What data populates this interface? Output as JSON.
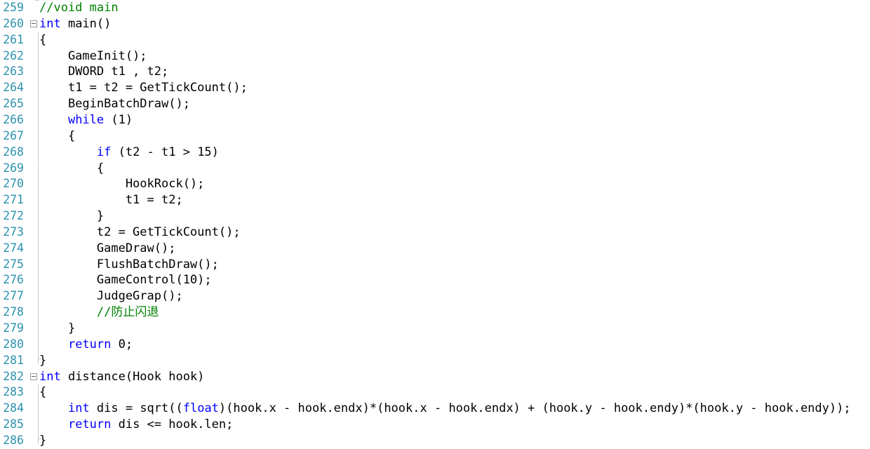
{
  "editor": {
    "name": "source-code-view",
    "language": "C++",
    "colors": {
      "background": "#ffffff",
      "line_number": "#2B91AF",
      "keyword": "#0000FF",
      "comment": "#008000",
      "plain_text": "#000000",
      "fold_guide": "#c8c8c8",
      "fold_box_border": "#9a9a9a"
    },
    "first_line_number": 259,
    "last_line_number": 286,
    "fold_markers": [
      260,
      282
    ]
  },
  "lines": [
    {
      "number": "259",
      "fold": false,
      "guide": "none",
      "tokens": [
        {
          "t": "//void main",
          "c": "cmt"
        }
      ]
    },
    {
      "number": "260",
      "fold": true,
      "guide": "none",
      "tokens": [
        {
          "t": "int",
          "c": "kw"
        },
        {
          "t": " main()",
          "c": "pl"
        }
      ]
    },
    {
      "number": "261",
      "fold": false,
      "guide": "line",
      "tokens": [
        {
          "t": "{",
          "c": "pl"
        }
      ]
    },
    {
      "number": "262",
      "fold": false,
      "guide": "line",
      "tokens": [
        {
          "t": "    GameInit();",
          "c": "pl"
        }
      ]
    },
    {
      "number": "263",
      "fold": false,
      "guide": "line",
      "tokens": [
        {
          "t": "    DWORD t1 , t2;",
          "c": "pl"
        }
      ]
    },
    {
      "number": "264",
      "fold": false,
      "guide": "line",
      "tokens": [
        {
          "t": "    t1 = t2 = GetTickCount();",
          "c": "pl"
        }
      ]
    },
    {
      "number": "265",
      "fold": false,
      "guide": "line",
      "tokens": [
        {
          "t": "    BeginBatchDraw();",
          "c": "pl"
        }
      ]
    },
    {
      "number": "266",
      "fold": false,
      "guide": "line",
      "tokens": [
        {
          "t": "    ",
          "c": "pl"
        },
        {
          "t": "while",
          "c": "kw"
        },
        {
          "t": " (1)",
          "c": "pl"
        }
      ]
    },
    {
      "number": "267",
      "fold": false,
      "guide": "line",
      "tokens": [
        {
          "t": "    {",
          "c": "pl"
        }
      ]
    },
    {
      "number": "268",
      "fold": false,
      "guide": "line",
      "tokens": [
        {
          "t": "        ",
          "c": "pl"
        },
        {
          "t": "if",
          "c": "kw"
        },
        {
          "t": " (t2 - t1 > 15)",
          "c": "pl"
        }
      ]
    },
    {
      "number": "269",
      "fold": false,
      "guide": "line",
      "tokens": [
        {
          "t": "        {",
          "c": "pl"
        }
      ]
    },
    {
      "number": "270",
      "fold": false,
      "guide": "line",
      "tokens": [
        {
          "t": "            HookRock();",
          "c": "pl"
        }
      ]
    },
    {
      "number": "271",
      "fold": false,
      "guide": "line",
      "tokens": [
        {
          "t": "            t1 = t2;",
          "c": "pl"
        }
      ]
    },
    {
      "number": "272",
      "fold": false,
      "guide": "line",
      "tokens": [
        {
          "t": "        }",
          "c": "pl"
        }
      ]
    },
    {
      "number": "273",
      "fold": false,
      "guide": "line",
      "tokens": [
        {
          "t": "        t2 = GetTickCount();",
          "c": "pl"
        }
      ]
    },
    {
      "number": "274",
      "fold": false,
      "guide": "line",
      "tokens": [
        {
          "t": "        GameDraw();",
          "c": "pl"
        }
      ]
    },
    {
      "number": "275",
      "fold": false,
      "guide": "line",
      "tokens": [
        {
          "t": "        FlushBatchDraw();",
          "c": "pl"
        }
      ]
    },
    {
      "number": "276",
      "fold": false,
      "guide": "line",
      "tokens": [
        {
          "t": "        GameControl(10);",
          "c": "pl"
        }
      ]
    },
    {
      "number": "277",
      "fold": false,
      "guide": "line",
      "tokens": [
        {
          "t": "        JudgeGrap();",
          "c": "pl"
        }
      ]
    },
    {
      "number": "278",
      "fold": false,
      "guide": "line",
      "tokens": [
        {
          "t": "        ",
          "c": "pl"
        },
        {
          "t": "//",
          "c": "cmt"
        },
        {
          "t": "防止闪退",
          "c": "cmt-cn"
        }
      ]
    },
    {
      "number": "279",
      "fold": false,
      "guide": "line",
      "tokens": [
        {
          "t": "    }",
          "c": "pl"
        }
      ]
    },
    {
      "number": "280",
      "fold": false,
      "guide": "line",
      "tokens": [
        {
          "t": "    ",
          "c": "pl"
        },
        {
          "t": "return",
          "c": "kw"
        },
        {
          "t": " 0;",
          "c": "pl"
        }
      ]
    },
    {
      "number": "281",
      "fold": false,
      "guide": "end",
      "tokens": [
        {
          "t": "}",
          "c": "pl"
        }
      ]
    },
    {
      "number": "282",
      "fold": true,
      "guide": "none",
      "tokens": [
        {
          "t": "int",
          "c": "kw"
        },
        {
          "t": " distance(Hook hook)",
          "c": "pl"
        }
      ]
    },
    {
      "number": "283",
      "fold": false,
      "guide": "line",
      "tokens": [
        {
          "t": "{",
          "c": "pl"
        }
      ]
    },
    {
      "number": "284",
      "fold": false,
      "guide": "line",
      "tokens": [
        {
          "t": "    ",
          "c": "pl"
        },
        {
          "t": "int",
          "c": "kw"
        },
        {
          "t": " dis = sqrt((",
          "c": "pl"
        },
        {
          "t": "float",
          "c": "kw"
        },
        {
          "t": ")(hook.x - hook.endx)*(hook.x - hook.endx) + (hook.y - hook.endy)*(hook.y - hook.endy));",
          "c": "pl"
        }
      ]
    },
    {
      "number": "285",
      "fold": false,
      "guide": "line",
      "tokens": [
        {
          "t": "    ",
          "c": "pl"
        },
        {
          "t": "return",
          "c": "kw"
        },
        {
          "t": " dis <= hook.len;",
          "c": "pl"
        }
      ]
    },
    {
      "number": "286",
      "fold": false,
      "guide": "end",
      "tokens": [
        {
          "t": "}",
          "c": "pl"
        }
      ]
    }
  ]
}
